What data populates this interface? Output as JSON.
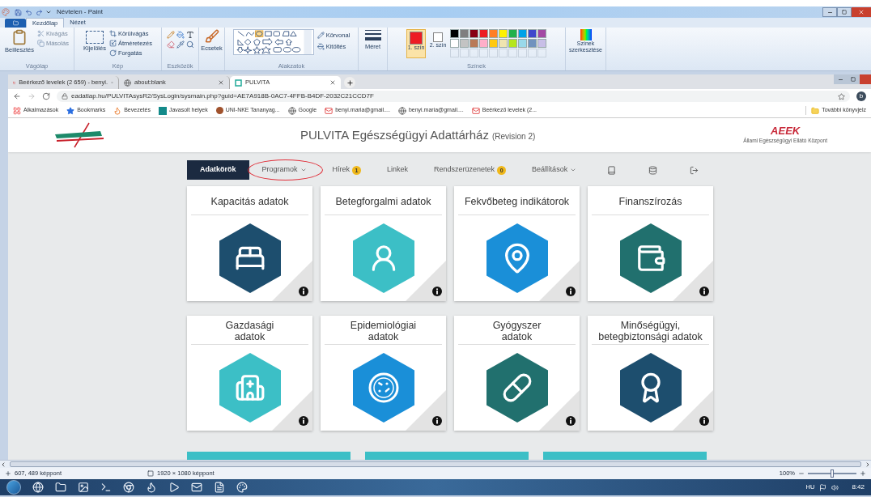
{
  "paint": {
    "title": "Névtelen - Paint",
    "ribbon_tabs": [
      {
        "label": "Kezdőlap",
        "selected": true
      },
      {
        "label": "Nézet",
        "selected": false
      }
    ],
    "clipboard": {
      "paste": "Beillesztés",
      "cut": "Kivágás",
      "copy": "Másolás",
      "group": "Vágólap"
    },
    "image": {
      "select": "Kijelölés",
      "crop": "Körülvágás",
      "resize": "Átméretezés",
      "rotate": "Forgatás",
      "group": "Kép"
    },
    "tools": {
      "group": "Eszközök"
    },
    "brushes": {
      "label": "Ecsetek"
    },
    "shapes": {
      "outline": "Körvonal",
      "fill": "Kitöltés",
      "group": "Alakzatok"
    },
    "size": {
      "label": "Méret"
    },
    "color1": {
      "label": "1. szín",
      "color": "#ed1c24"
    },
    "color2": {
      "label": "2. szín",
      "color": "#ffffff"
    },
    "palette": [
      {
        "color": "#000000"
      },
      {
        "color": "#7f7f7f"
      },
      {
        "color": "#880015"
      },
      {
        "color": "#ed1c24"
      },
      {
        "color": "#ff7f27"
      },
      {
        "color": "#fff200"
      },
      {
        "color": "#22b14c"
      },
      {
        "color": "#00a2e8"
      },
      {
        "color": "#3f48cc"
      },
      {
        "color": "#a349a4"
      },
      {
        "color": "#ffffff"
      },
      {
        "color": "#c3c3c3"
      },
      {
        "color": "#b97a57"
      },
      {
        "color": "#ffaec9"
      },
      {
        "color": "#ffc90e"
      },
      {
        "color": "#efe4b0"
      },
      {
        "color": "#b5e61d"
      },
      {
        "color": "#99d9ea"
      },
      {
        "color": "#7092be"
      },
      {
        "color": "#c8bfe7"
      }
    ],
    "colors_group": "Színek",
    "edit_colors": "Színek szerkesztése",
    "status": {
      "cursor": "607, 489 képpont",
      "dimensions": "1920 × 1080 képpont",
      "zoom": "100%",
      "zoom_slider": {
        "level": 0.5
      }
    }
  },
  "browser": {
    "tabs": [
      {
        "title": "Beérkező levelek (2 659) - benyi.",
        "selected": false
      },
      {
        "title": "about:blank",
        "selected": false
      },
      {
        "title": "PULVITA",
        "selected": true
      }
    ],
    "url": "eadatlap.hu/PULVITAsysR2/SysLogin/sysmain.php?guid=AE7A918B-0AC7-4FFB-B4DF-2032C21CCD7F",
    "profile_initial": "b",
    "bookmarks": [
      "Alkalmazások",
      "Bookmarks",
      "Bevezetés",
      "Javasolt helyek",
      "UNI-NKE  Tananyag...",
      "Google",
      "benyi.maria@gmail....",
      "benyi.maria@gmail....",
      "Beérkező levelek (2..."
    ],
    "other_bookmarks": "További könyvjelz"
  },
  "page": {
    "title": "PULVITA Egészségügyi Adattárház",
    "revision": "(Revision 2)",
    "agency_logo": "AEEK",
    "agency_name": "Állami Egészségügyi Ellátó Központ",
    "nav": [
      {
        "label": "Adatkörök",
        "selected": true,
        "dropdown": false,
        "circled": false
      },
      {
        "label": "Programok",
        "selected": false,
        "dropdown": true,
        "circled": true
      },
      {
        "label": "Hírek",
        "selected": false,
        "dropdown": false,
        "circled": false,
        "badge": "1"
      },
      {
        "label": "Linkek",
        "selected": false,
        "dropdown": false,
        "circled": false
      },
      {
        "label": "Rendszerüzenetek",
        "selected": false,
        "dropdown": false,
        "circled": false,
        "badge": "0"
      },
      {
        "label": "Beállítások",
        "selected": false,
        "dropdown": true,
        "circled": false
      }
    ],
    "cards": [
      {
        "title": "Kapacitás adatok",
        "color": "#1d4e6e"
      },
      {
        "title": "Betegforgalmi adatok",
        "color": "#3cbfc6"
      },
      {
        "title": "Fekvőbeteg indikátorok",
        "color": "#1a8fd8"
      },
      {
        "title": "Finanszírozás",
        "color": "#21706e"
      },
      {
        "title": "Gazdasági\nadatok",
        "color": "#3cbfc6"
      },
      {
        "title": "Epidemiológiai\nadatok",
        "color": "#1a8fd8"
      },
      {
        "title": "Gyógyszer\nadatok",
        "color": "#21706e"
      },
      {
        "title": "Minőségügyi,\nbetegbiztonsági adatok",
        "color": "#1d4e6e"
      }
    ]
  },
  "taskbar": {
    "language": "HU",
    "time": "8:42"
  }
}
